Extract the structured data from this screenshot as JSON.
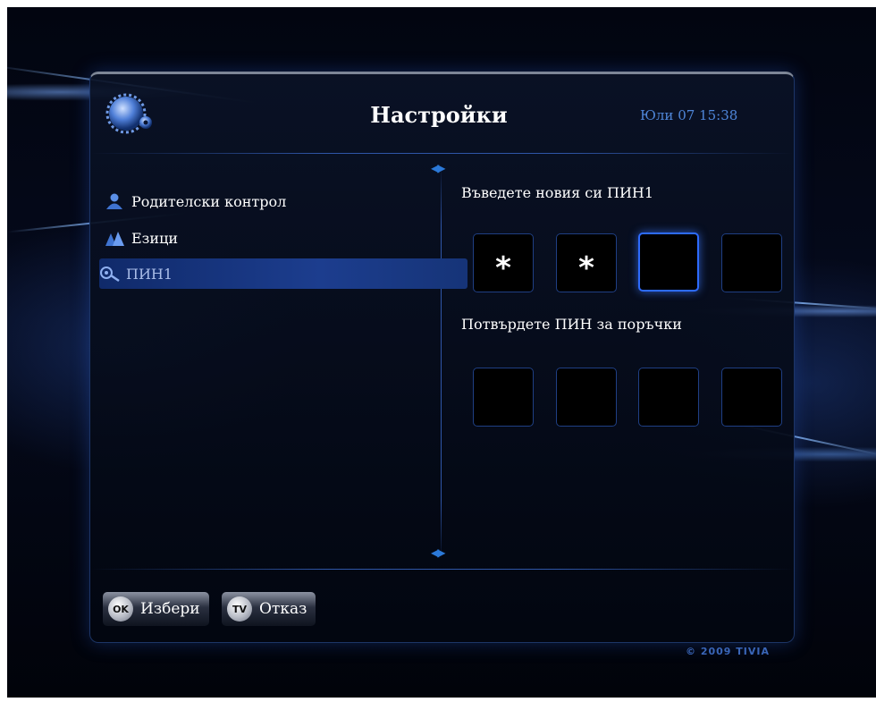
{
  "header": {
    "title": "Настройки",
    "clock": "Юли 07 15:38"
  },
  "sidebar": {
    "items": [
      {
        "label": "Родителски контрол",
        "icon": "person-icon",
        "selected": false
      },
      {
        "label": "Езици",
        "icon": "languages-icon",
        "selected": false
      },
      {
        "label": "ПИН1",
        "icon": "pin-key-icon",
        "selected": true
      }
    ]
  },
  "pin_form": {
    "new_pin_prompt": "Въведете новия си ПИН1",
    "new_pin_boxes": [
      "*",
      "*",
      "",
      ""
    ],
    "confirm_prompt": "Потвърдете ПИН за поръчки",
    "confirm_boxes": [
      "",
      "",
      "",
      ""
    ]
  },
  "footer": {
    "buttons": [
      {
        "badge": "OK",
        "label": "Избери"
      },
      {
        "badge": "TV",
        "label": "Отказ"
      }
    ],
    "copyright": "© 2009 TIVIA"
  },
  "colors": {
    "accent": "#2d6bff",
    "clock": "#4f86d9",
    "selection": "#1c3d8e"
  }
}
